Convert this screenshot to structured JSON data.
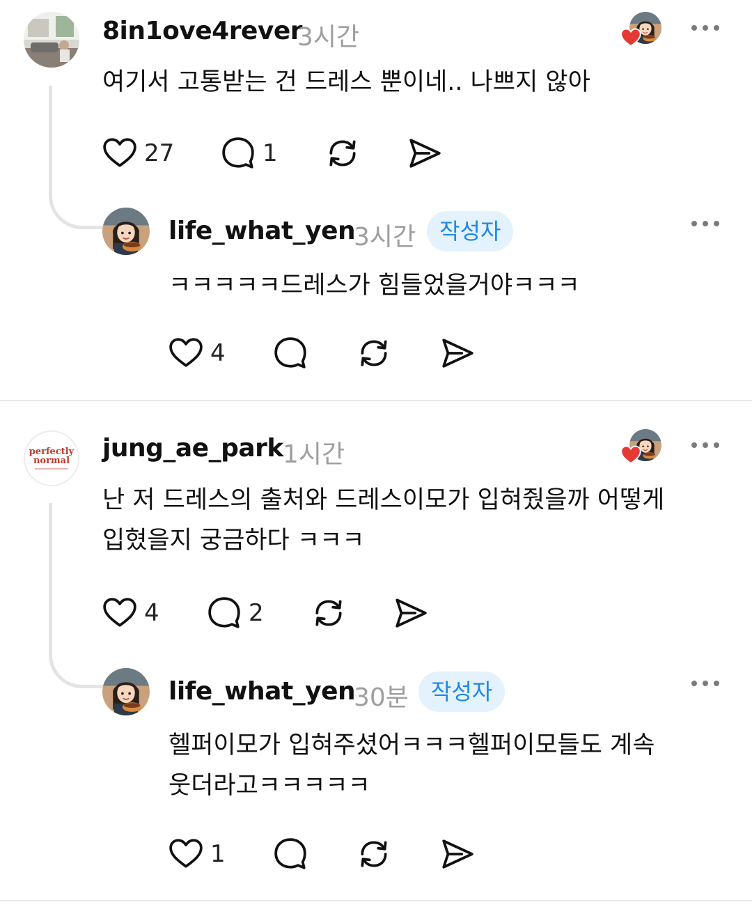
{
  "threads": [
    {
      "comment": {
        "username": "8in1ove4rever",
        "time": "3시간",
        "text_lines": [
          "여기서 고통받는 건  드레스 뿐이네.. 나쁘지 않아"
        ],
        "likes": "27",
        "replies": "1"
      },
      "reply": {
        "username": "life_what_yen",
        "time": "3시간",
        "badge": "작성자",
        "text_lines": [
          "ㅋㅋㅋㅋㅋ드레스가 힘들었을거야ㅋㅋㅋ"
        ],
        "likes": "4"
      }
    },
    {
      "comment": {
        "username": "jung_ae_park",
        "time": "1시간",
        "avatar_text": [
          "perfectly",
          "normal"
        ],
        "text_lines": [
          "난 저 드레스의 출처와 드레스이모가 입혀줬을까 어떻게",
          "입혔을지 궁금하다 ㅋㅋㅋ"
        ],
        "likes": "4",
        "replies": "2"
      },
      "reply": {
        "username": "life_what_yen",
        "time": "30분",
        "badge": "작성자",
        "text_lines": [
          "헬퍼이모가 입혀주셨어ㅋㅋㅋ헬퍼이모들도 계속",
          "웃더라고ㅋㅋㅋㅋㅋ"
        ],
        "likes": "1"
      }
    }
  ],
  "icons": {
    "like": "heart-icon",
    "reply": "comment-bubble-icon",
    "repost": "repost-icon",
    "share": "send-icon",
    "more": "more-dots-icon",
    "liked_by_author": "author-liked-heart-icon"
  },
  "colors": {
    "badge_bg": "#e3f2fd",
    "badge_text": "#1e88e5",
    "liked_heart": "#e53935",
    "muted_text": "#9e9e9e",
    "divider": "#e9e9e9"
  }
}
